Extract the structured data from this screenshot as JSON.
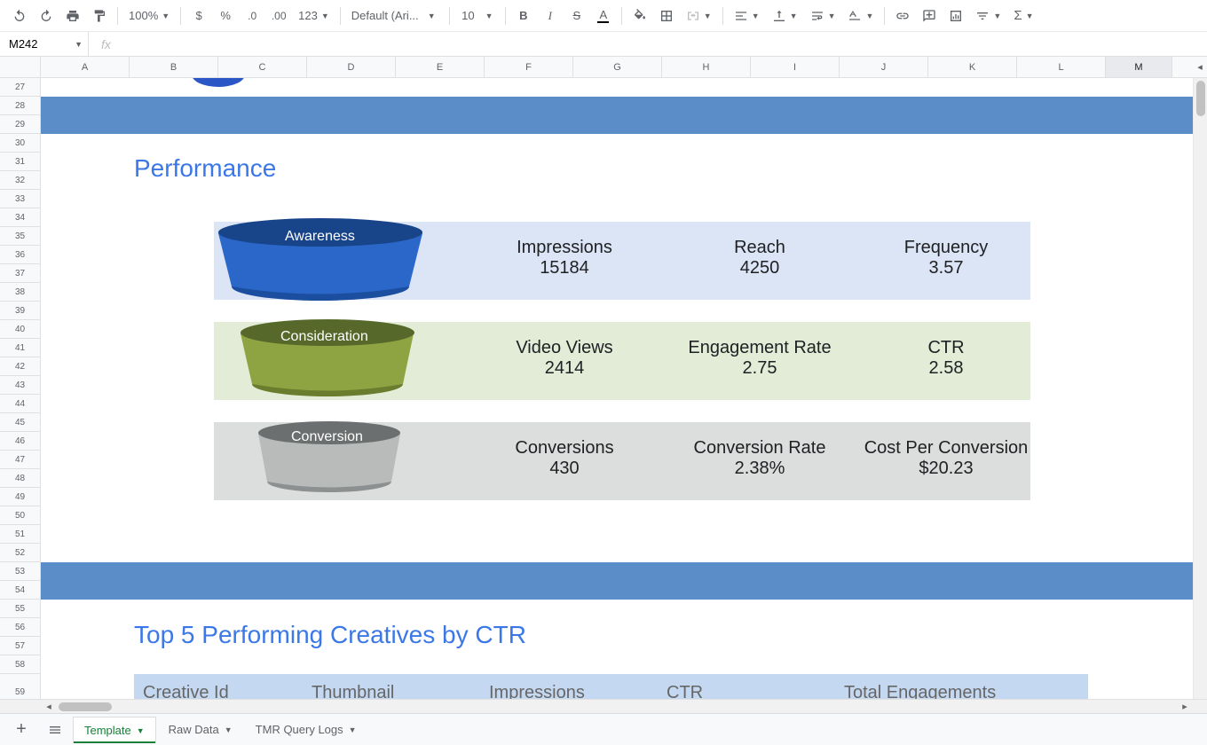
{
  "name_box": "M242",
  "toolbar": {
    "zoom": "100%",
    "font": "Default (Ari...",
    "font_size": "10",
    "number_format": "123"
  },
  "columns": [
    "A",
    "B",
    "C",
    "D",
    "E",
    "F",
    "G",
    "H",
    "I",
    "J",
    "K",
    "L",
    "M"
  ],
  "row_start": 27,
  "row_end": 59,
  "sections": {
    "performance_title": "Performance",
    "creatives_title": "Top 5 Performing Creatives by CTR"
  },
  "funnel": {
    "awareness": {
      "label": "Awareness",
      "metrics": [
        {
          "label": "Impressions",
          "value": "15184"
        },
        {
          "label": "Reach",
          "value": "4250"
        },
        {
          "label": "Frequency",
          "value": "3.57"
        }
      ]
    },
    "consideration": {
      "label": "Consideration",
      "metrics": [
        {
          "label": "Video Views",
          "value": "2414"
        },
        {
          "label": "Engagement Rate",
          "value": "2.75"
        },
        {
          "label": "CTR",
          "value": "2.58"
        }
      ]
    },
    "conversion": {
      "label": "Conversion",
      "metrics": [
        {
          "label": "Conversions",
          "value": "430"
        },
        {
          "label": "Conversion Rate",
          "value": "2.38%"
        },
        {
          "label": "Cost Per Conversion",
          "value": "$20.23"
        }
      ]
    }
  },
  "table_headers": [
    "Creative Id",
    "Thumbnail",
    "Impressions",
    "CTR",
    "Total Engagements"
  ],
  "sheet_tabs": {
    "active": "Template",
    "others": [
      "Raw Data",
      "TMR Query Logs"
    ]
  }
}
